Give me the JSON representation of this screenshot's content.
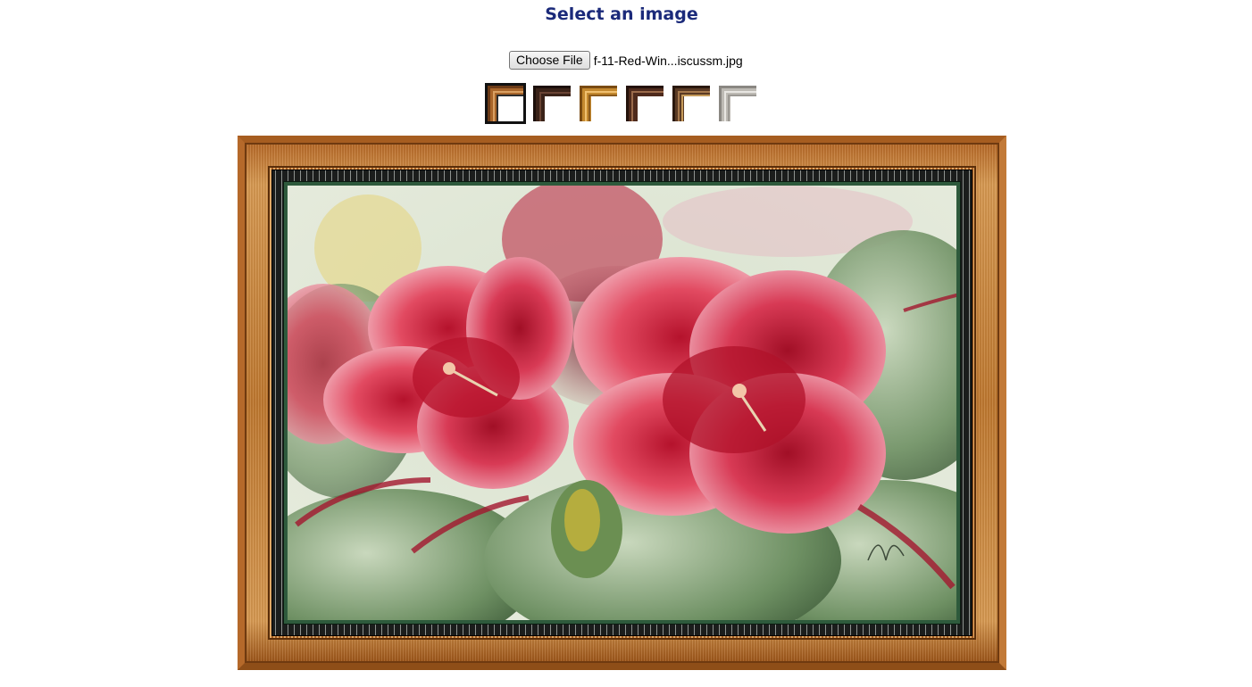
{
  "page": {
    "title": "Select an image"
  },
  "file_input": {
    "button_label": "Choose File",
    "file_name": "f-11-Red-Win...iscussm.jpg"
  },
  "frame_options": [
    {
      "name": "frame-option-1",
      "selected": true,
      "color": "#a8652a"
    },
    {
      "name": "frame-option-2",
      "selected": false,
      "color": "#3a2218"
    },
    {
      "name": "frame-option-3",
      "selected": false,
      "color": "#c4892f"
    },
    {
      "name": "frame-option-4",
      "selected": false,
      "color": "#4e2a1c"
    },
    {
      "name": "frame-option-5",
      "selected": false,
      "color": "#5a3a24"
    },
    {
      "name": "frame-option-6",
      "selected": false,
      "color": "#bdbab4"
    }
  ],
  "artwork": {
    "signature": "Martin"
  },
  "colors": {
    "title": "#1b2a7a",
    "frame_wood": "#c07930",
    "mat": "#2e5a3c",
    "greek_key_band": "#1b1d1c"
  }
}
